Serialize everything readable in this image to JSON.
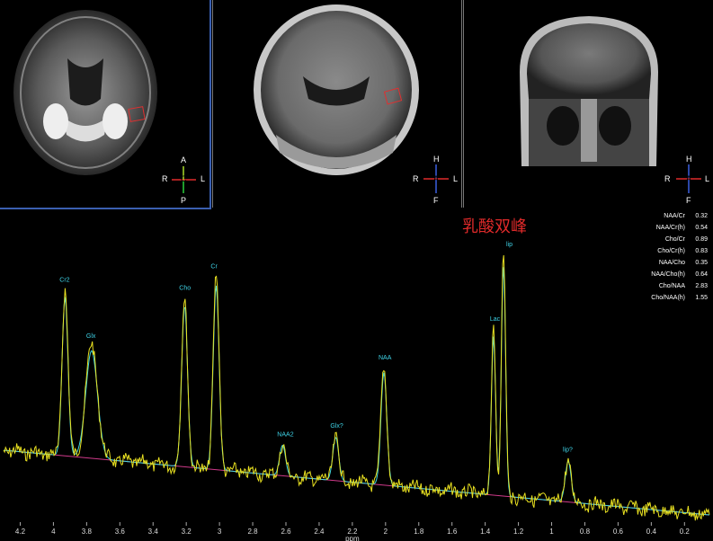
{
  "viewports": [
    {
      "name": "axial",
      "orientation": {
        "top": "A",
        "bottom": "P",
        "left": "R",
        "right": "L",
        "center": "C"
      }
    },
    {
      "name": "coronal-1",
      "orientation": {
        "top": "H",
        "bottom": "F",
        "left": "R",
        "right": "L",
        "center": "A"
      }
    },
    {
      "name": "coronal-2",
      "orientation": {
        "top": "H",
        "bottom": "F",
        "left": "R",
        "right": "L",
        "center": "A"
      }
    }
  ],
  "annotation": "乳酸双峰",
  "ratios": [
    {
      "label": "NAA/Cr",
      "value": "0.32"
    },
    {
      "label": "NAA/Cr(h)",
      "value": "0.54"
    },
    {
      "label": "Cho/Cr",
      "value": "0.89"
    },
    {
      "label": "Cho/Cr(h)",
      "value": "0.83"
    },
    {
      "label": "NAA/Cho",
      "value": "0.35"
    },
    {
      "label": "NAA/Cho(h)",
      "value": "0.64"
    },
    {
      "label": "Cho/NAA",
      "value": "2.83"
    },
    {
      "label": "Cho/NAA(h)",
      "value": "1.55"
    }
  ],
  "chart_data": {
    "type": "line",
    "xlabel": "ppm",
    "x_ticks": [
      "4.2",
      "4",
      "3.8",
      "3.6",
      "3.4",
      "3.2",
      "3",
      "2.8",
      "2.6",
      "2.4",
      "2.2",
      "2",
      "1.8",
      "1.6",
      "1.4",
      "1.2",
      "1",
      "0.8",
      "0.6",
      "0.4",
      "0.2"
    ],
    "xlim": [
      4.3,
      0.05
    ],
    "peaks": [
      {
        "label": "Cr2",
        "ppm": 3.93,
        "height": 0.62
      },
      {
        "label": "Glx",
        "ppm": 3.77,
        "height": 0.42
      },
      {
        "label": "Cho",
        "ppm": 3.21,
        "height": 0.63
      },
      {
        "label": "Cr",
        "ppm": 3.02,
        "height": 0.72
      },
      {
        "label": "NAA2",
        "ppm": 2.62,
        "height": 0.12
      },
      {
        "label": "Glx?",
        "ppm": 2.3,
        "height": 0.17
      },
      {
        "label": "NAA",
        "ppm": 2.01,
        "height": 0.44
      },
      {
        "label": "Lac",
        "ppm": 1.35,
        "height": 0.62
      },
      {
        "label": "lip",
        "ppm": 1.29,
        "height": 0.9
      },
      {
        "label": "lip?",
        "ppm": 0.9,
        "height": 0.16
      }
    ],
    "grid": false,
    "colors": {
      "spectrum": "#e8e020",
      "fit": "#40d8e0",
      "baseline": "#d03a8a"
    }
  }
}
